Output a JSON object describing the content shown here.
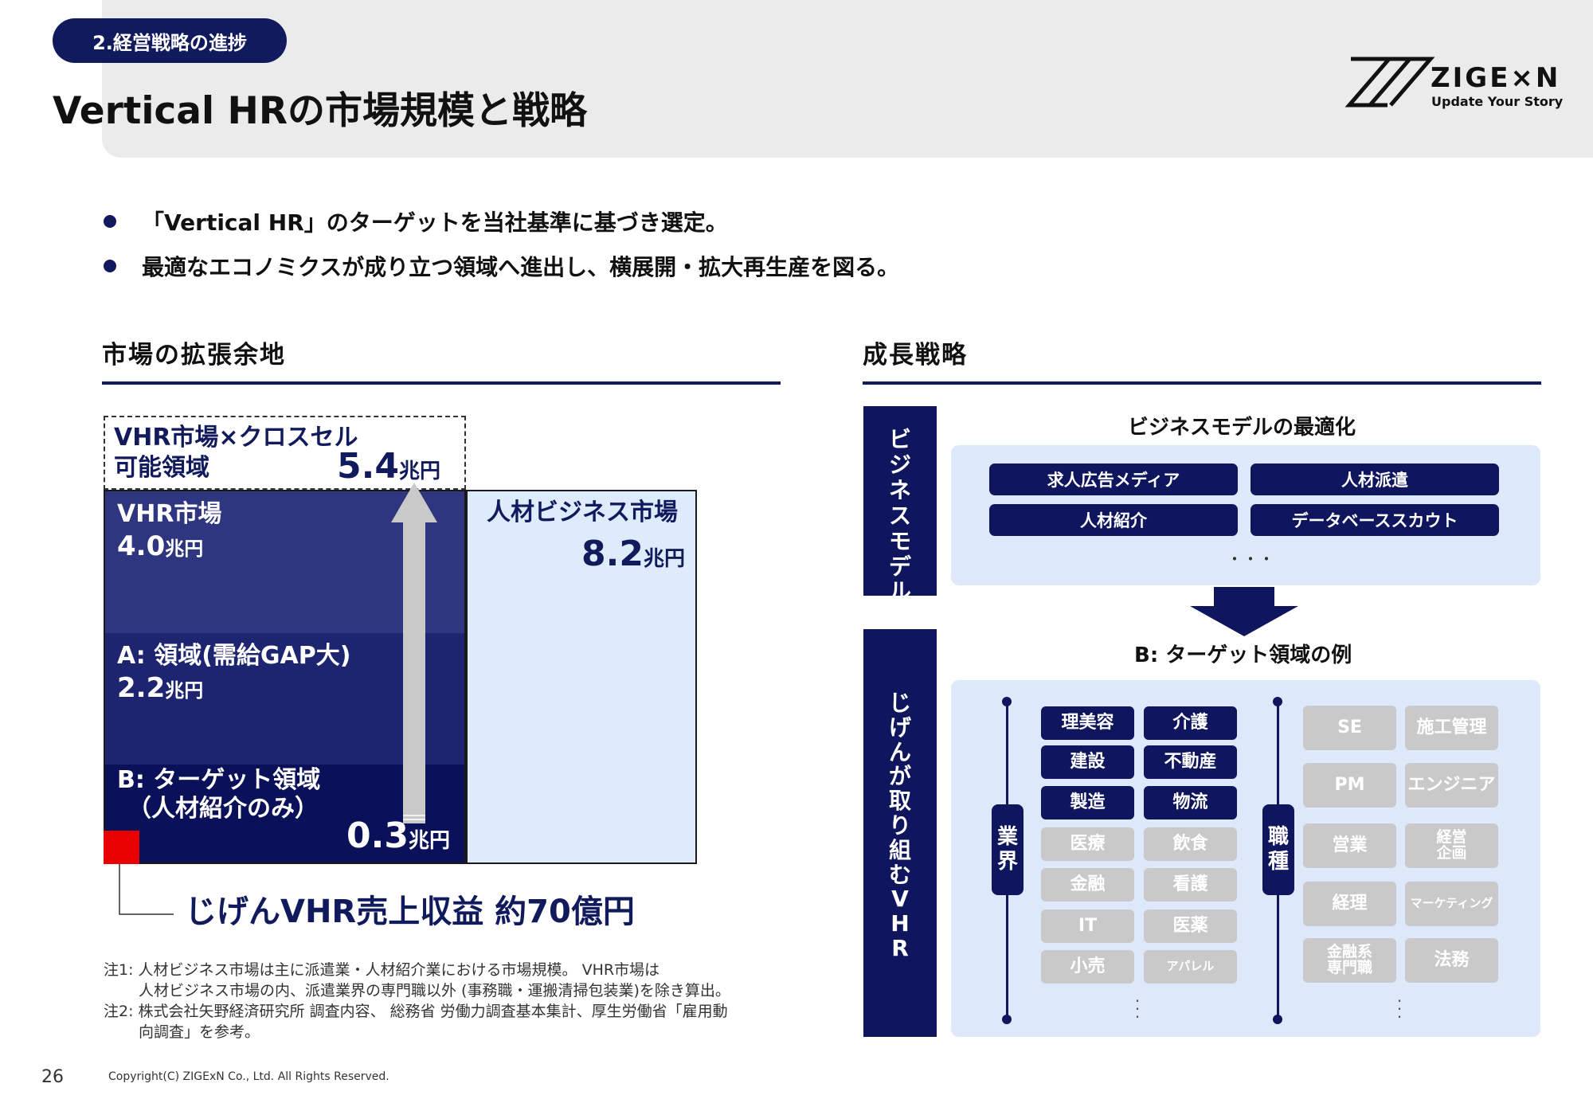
{
  "header": {
    "section": "2.経営戦略の進捗",
    "title": "Vertical HRの市場規模と戦略",
    "logo_name": "ZIGE×N",
    "logo_tagline": "Update Your Story"
  },
  "bullets": [
    "「Vertical HR」のターゲットを当社基準に基づき選定。",
    "最適なエコノミクスが成り立つ領域へ進出し、横展開・拡大再生産を図る。"
  ],
  "left": {
    "section_title": "市場の拡張余地",
    "cross_label_1": "VHR市場×クロスセル",
    "cross_label_2": "可能領域",
    "cross_value": "5.4",
    "vhr_label": "VHR市場",
    "vhr_value": "4.0",
    "a_label": "A: 領域(需給GAP大)",
    "a_value": "2.2",
    "b_label_1": "B: ターゲット領域",
    "b_label_2": "（人材紹介のみ）",
    "b_value": "0.3",
    "jinzai_label": "人材ビジネス市場",
    "jinzai_value": "8.2",
    "unit": "兆円",
    "revenue": "じげんVHR売上収益 約70億円",
    "note1_a": "注1: 人材ビジネス市場は主に派遣業・人材紹介業における市場規模。 VHR市場は",
    "note1_b": "人材ビジネス市場の内、派遣業界の専門職以外 (事務職・運搬清掃包装業)を除き算出。",
    "note2_a": "注2: 株式会社矢野経済研究所 調査内容、 総務省 労働力調査基本集計、厚生労働省「雇用動",
    "note2_b": "向調査」を参考。"
  },
  "right": {
    "section_title": "成長戦略",
    "band1": "ビジネスモデル",
    "band2": "じげんが取り組むVHR",
    "bm_title": "ビジネスモデルの最適化",
    "bm_items": [
      "求人広告メディア",
      "人材派遣",
      "人材紹介",
      "データベーススカウト"
    ],
    "bm_more": "・・・",
    "target_title": "B: ターゲット領域の例",
    "industry_axis": "業界",
    "job_axis": "職種",
    "industries_dark": [
      "理美容",
      "介護",
      "建設",
      "不動産",
      "製造",
      "物流"
    ],
    "industries_gray": [
      "医療",
      "飲食",
      "金融",
      "看護",
      "IT",
      "医薬",
      "小売",
      "アパレル"
    ],
    "jobs": [
      "SE",
      "施工管理",
      "PM",
      "エンジニア",
      "営業",
      "経営企画",
      "経理",
      "マーケティング",
      "金融系専門職",
      "法務"
    ],
    "jobs_display": {
      "keiei_1": "経営",
      "keiei_2": "企画",
      "kinyu_1": "金融系",
      "kinyu_2": "専門職"
    }
  },
  "footer": {
    "page": "26",
    "copyright": "Copyright(C)  ZIGExN Co., Ltd. All Rights Reserved."
  },
  "colors": {
    "navy": "#121a5e",
    "vhr_block": "#2d367f",
    "a_block": "#1d2570",
    "b_block": "#0b1158",
    "jinzai_block": "#deebfb",
    "red": "#e80000",
    "gray_tag": "#c9c9c9",
    "panel": "#dde9fa"
  }
}
